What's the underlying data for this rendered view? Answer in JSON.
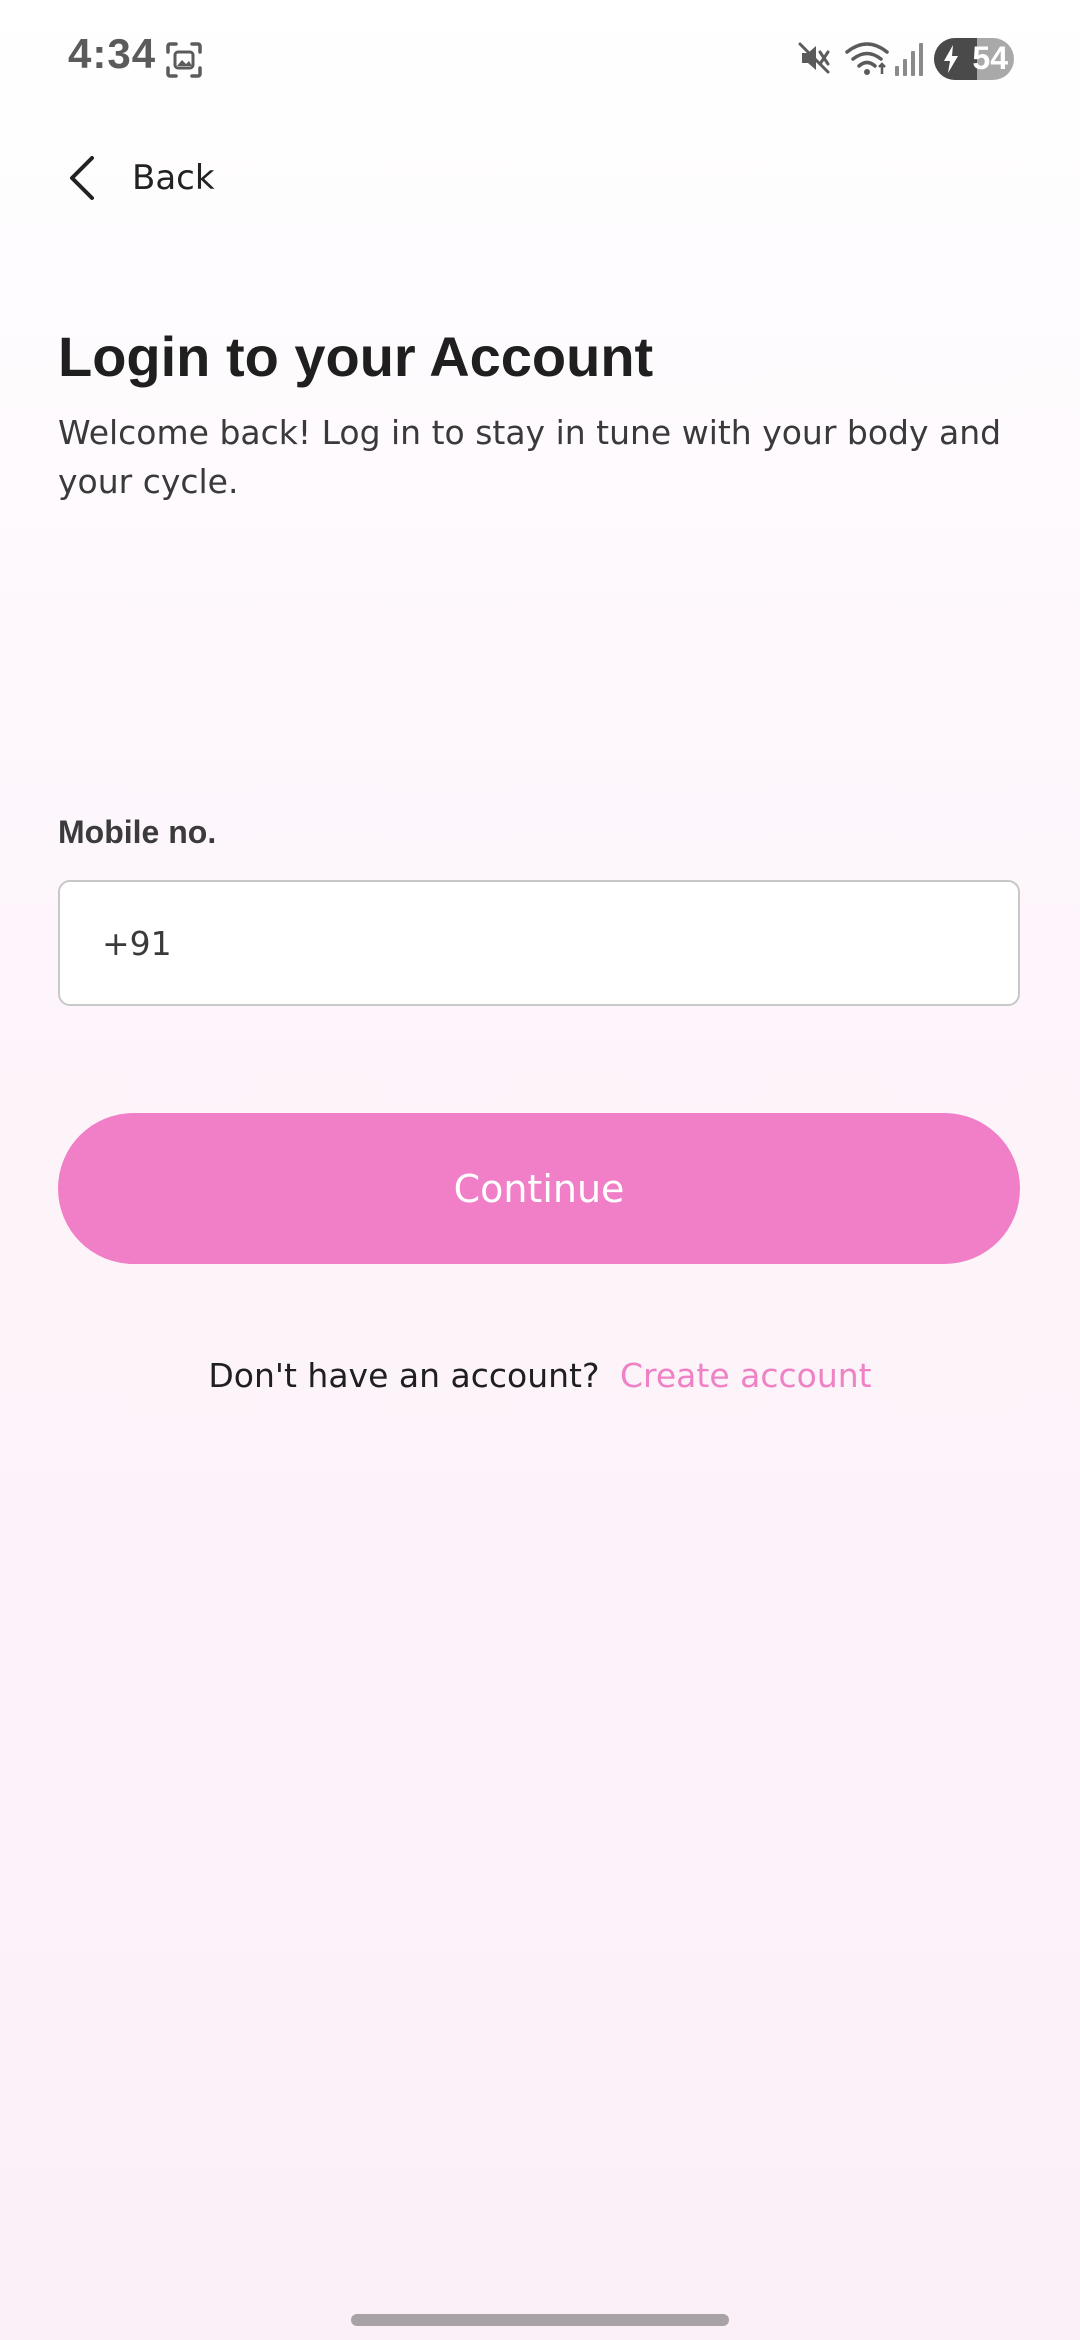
{
  "status_bar": {
    "time": "4:34",
    "battery_percent": "54",
    "battery_level": 0.54,
    "icons": [
      "screenshot-icon",
      "mute-icon",
      "wifi-icon",
      "signal-icon",
      "battery-icon"
    ]
  },
  "nav": {
    "back_label": "Back"
  },
  "header": {
    "title": "Login to your Account",
    "subtitle": "Welcome back! Log in to stay in tune with your body and your cycle."
  },
  "form": {
    "mobile_label": "Mobile no.",
    "country_code": "+91",
    "mobile_value": "",
    "mobile_placeholder": ""
  },
  "actions": {
    "continue_label": "Continue"
  },
  "footer": {
    "prompt": "Don't have an account?",
    "create_link": "Create account"
  },
  "colors": {
    "accent": "#f07fc8",
    "link": "#ee82c4"
  }
}
